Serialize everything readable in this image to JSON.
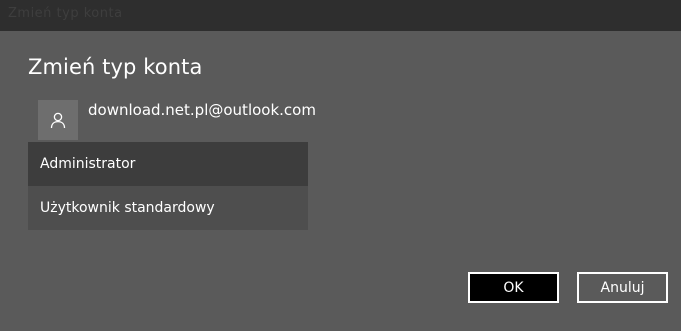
{
  "window": {
    "background_title": "Zmień typ konta"
  },
  "dialog": {
    "title": "Zmień typ konta",
    "account": {
      "avatar_icon": "person-icon",
      "email": "download.net.pl@outlook.com"
    },
    "account_types": [
      {
        "label": "Administrator",
        "selected": true
      },
      {
        "label": "Użytkownik standardowy",
        "selected": false
      }
    ],
    "buttons": {
      "ok_label": "OK",
      "cancel_label": "Anuluj"
    }
  },
  "colors": {
    "dialog_background": "#5a5a5a",
    "selected_option": "#3d3d3d",
    "unselected_option": "#4e4e4e",
    "primary_button": "#000000",
    "text": "#ffffff"
  }
}
